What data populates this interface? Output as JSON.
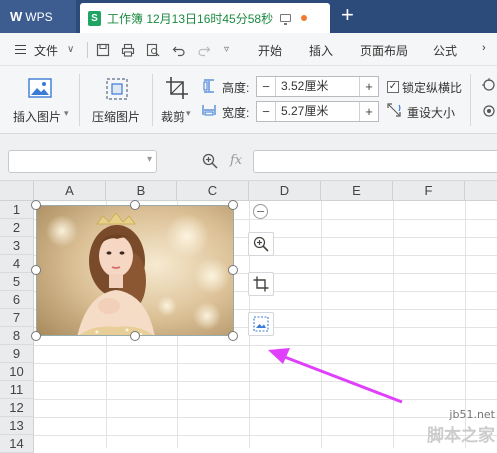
{
  "tabbar": {
    "app_label": "WPS",
    "doc_tab_title": "工作簿 12月13日16时45分58秒",
    "doc_icon_letter": "S",
    "new_tab": "+"
  },
  "menubar": {
    "file": "文件",
    "items": [
      "开始",
      "插入",
      "页面布局",
      "公式"
    ]
  },
  "ribbon": {
    "insert_picture": "插入图片",
    "compress_picture": "压缩图片",
    "crop": "裁剪",
    "height_label": "高度:",
    "height_value": "3.52厘米",
    "width_label": "宽度:",
    "width_value": "5.27厘米",
    "lock_ratio": "锁定纵横比",
    "lock_ratio_checked": true,
    "reset_size": "重设大小",
    "minus": "−",
    "plus": "+"
  },
  "formula_bar": {
    "name_box": "",
    "fx": "fx",
    "formula": ""
  },
  "sheet": {
    "columns": [
      "A",
      "B",
      "C",
      "D",
      "E",
      "F"
    ],
    "rows": [
      "1",
      "2",
      "3",
      "4",
      "5",
      "6",
      "7",
      "8",
      "9",
      "10",
      "11",
      "12",
      "13",
      "14"
    ]
  },
  "watermark": {
    "url": "jb51.net",
    "name": "脚本之家"
  },
  "colors": {
    "annotation_arrow": "#e040fb",
    "title_bar": "#2c4a7a",
    "doc_title": "#1b8a3f"
  }
}
